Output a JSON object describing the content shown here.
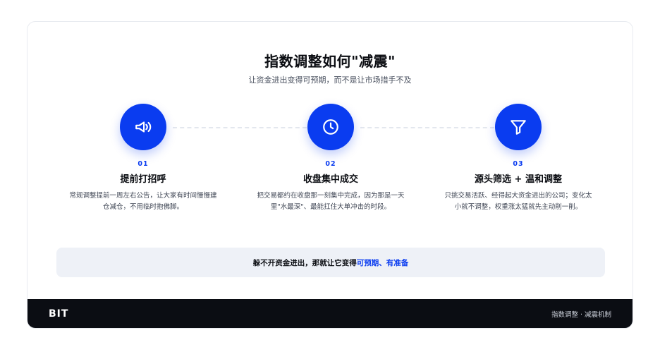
{
  "header": {
    "title": "指数调整如何\"减震\"",
    "subtitle": "让资金进出变得可预期，而不是让市场措手不及"
  },
  "steps": [
    {
      "number": "01",
      "icon": "megaphone-icon",
      "title": "提前打招呼",
      "description": "常规调整提前一周左右公告，让大家有时间慢慢建仓减仓，不用临时抱佛脚。"
    },
    {
      "number": "02",
      "icon": "clock-icon",
      "title": "收盘集中成交",
      "description": "把交易都约在收盘那一刻集中完成，因为那是一天里\"水最深\"、最能扛住大单冲击的时段。"
    },
    {
      "number": "03",
      "icon": "filter-icon",
      "title": "源头筛选 + 温和调整",
      "description": "只挑交易活跃、经得起大资金进出的公司；变化太小就不调整，权重涨太猛就先主动削一削。"
    }
  ],
  "banner": {
    "text_before": "躲不开资金进出，那就让它变得",
    "highlight": "可预期、有准备"
  },
  "footer": {
    "brand": "BIT",
    "note": "指数调整 · 减震机制"
  },
  "colors": {
    "accent": "#0a3cf0",
    "footer_bg": "#0b0d13",
    "banner_bg": "#eef1f7"
  }
}
